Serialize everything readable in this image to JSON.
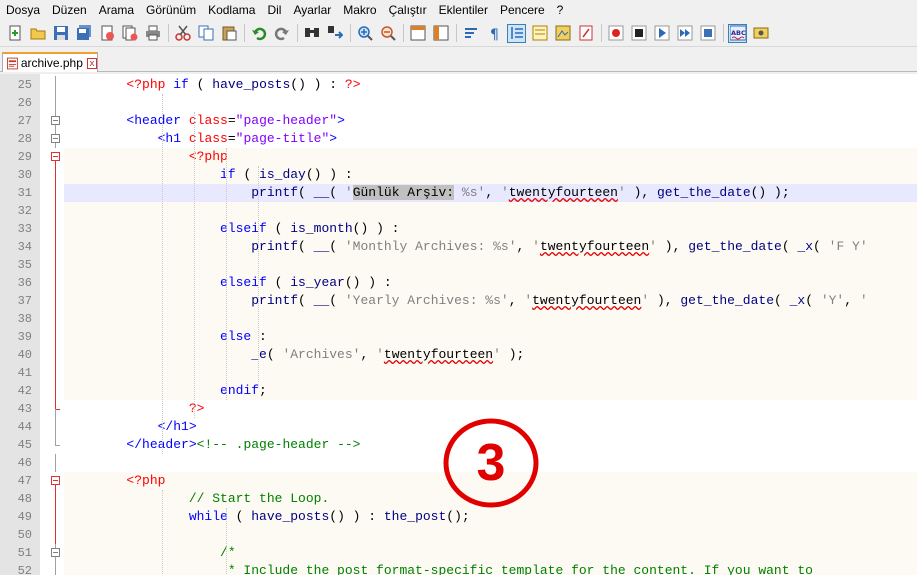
{
  "menu": [
    "Dosya",
    "Düzen",
    "Arama",
    "Görünüm",
    "Kodlama",
    "Dil",
    "Ayarlar",
    "Makro",
    "Çalıştır",
    "Eklentiler",
    "Pencere",
    "?"
  ],
  "tab": {
    "filename": "archive.php",
    "close": "x"
  },
  "badge": "3",
  "toolbar_icons": [
    "new-file-icon",
    "open-file-icon",
    "save-icon",
    "save-all-icon",
    "close-icon",
    "close-all-icon",
    "print-icon",
    "cut-icon",
    "copy-icon",
    "paste-icon",
    "undo-icon",
    "redo-icon",
    "find-icon",
    "replace-icon",
    "zoom-in-icon",
    "zoom-out-icon",
    "sync-v-icon",
    "sync-h-icon",
    "word-wrap-icon",
    "show-all-chars-icon",
    "indent-guide-icon",
    "udl-icon",
    "doc-map-icon",
    "function-list-icon",
    "record-macro-icon",
    "stop-macro-icon",
    "play-macro-icon",
    "run-macro-multiple-icon",
    "save-macro-icon",
    "spell-check-icon",
    "spell-options-icon"
  ],
  "lines": [
    {
      "n": "25",
      "bg": false,
      "cur": false,
      "fold": "line",
      "tokens": [
        [
          "t",
          "        "
        ],
        [
          "ph",
          "<?php"
        ],
        [
          "t",
          " "
        ],
        [
          "kw",
          "if"
        ],
        [
          "pu",
          " ( "
        ],
        [
          "fn",
          "have_posts"
        ],
        [
          "pu",
          "() ) : "
        ],
        [
          "ph",
          "?>"
        ]
      ]
    },
    {
      "n": "26",
      "bg": false,
      "cur": false,
      "fold": "line",
      "tokens": []
    },
    {
      "n": "27",
      "bg": false,
      "cur": false,
      "fold": "box",
      "tokens": [
        [
          "t",
          "        "
        ],
        [
          "tg",
          "<header"
        ],
        [
          "t",
          " "
        ],
        [
          "at",
          "class"
        ],
        [
          "pu",
          "="
        ],
        [
          "av",
          "\"page-header\""
        ],
        [
          "tg",
          ">"
        ]
      ]
    },
    {
      "n": "28",
      "bg": false,
      "cur": false,
      "fold": "box",
      "tokens": [
        [
          "t",
          "            "
        ],
        [
          "tg",
          "<h1"
        ],
        [
          "t",
          " "
        ],
        [
          "at",
          "class"
        ],
        [
          "pu",
          "="
        ],
        [
          "av",
          "\"page-title\""
        ],
        [
          "tg",
          ">"
        ]
      ]
    },
    {
      "n": "29",
      "bg": true,
      "cur": false,
      "fold": "boxred",
      "tokens": [
        [
          "t",
          "                "
        ],
        [
          "ph",
          "<?php"
        ]
      ]
    },
    {
      "n": "30",
      "bg": true,
      "cur": false,
      "fold": "redline",
      "tokens": [
        [
          "t",
          "                    "
        ],
        [
          "kw",
          "if"
        ],
        [
          "pu",
          " ( "
        ],
        [
          "fn",
          "is_day"
        ],
        [
          "pu",
          "() ) :"
        ]
      ]
    },
    {
      "n": "31",
      "bg": true,
      "cur": true,
      "fold": "redline",
      "tokens": [
        [
          "t",
          "                        "
        ],
        [
          "fn",
          "printf"
        ],
        [
          "pu",
          "( "
        ],
        [
          "fn",
          "__"
        ],
        [
          "pu",
          "( "
        ],
        [
          "st",
          "'"
        ],
        [
          "sel",
          "Günlük Arşiv:"
        ],
        [
          "st",
          " %s'"
        ],
        [
          "pu",
          ", "
        ],
        [
          "st",
          "'"
        ],
        [
          "wavy",
          "twentyfourteen"
        ],
        [
          "st",
          "'"
        ],
        [
          "pu",
          " ), "
        ],
        [
          "fn",
          "get_the_date"
        ],
        [
          "pu",
          "() );"
        ]
      ]
    },
    {
      "n": "32",
      "bg": true,
      "cur": false,
      "fold": "redline",
      "tokens": []
    },
    {
      "n": "33",
      "bg": true,
      "cur": false,
      "fold": "redline",
      "tokens": [
        [
          "t",
          "                    "
        ],
        [
          "kw",
          "elseif"
        ],
        [
          "pu",
          " ( "
        ],
        [
          "fn",
          "is_month"
        ],
        [
          "pu",
          "() ) :"
        ]
      ]
    },
    {
      "n": "34",
      "bg": true,
      "cur": false,
      "fold": "redline",
      "tokens": [
        [
          "t",
          "                        "
        ],
        [
          "fn",
          "printf"
        ],
        [
          "pu",
          "( "
        ],
        [
          "fn",
          "__"
        ],
        [
          "pu",
          "( "
        ],
        [
          "st",
          "'Monthly Archives: %s'"
        ],
        [
          "pu",
          ", "
        ],
        [
          "st",
          "'"
        ],
        [
          "wavy",
          "twentyfourteen"
        ],
        [
          "st",
          "'"
        ],
        [
          "pu",
          " ), "
        ],
        [
          "fn",
          "get_the_date"
        ],
        [
          "pu",
          "( "
        ],
        [
          "fn",
          "_x"
        ],
        [
          "pu",
          "( "
        ],
        [
          "st",
          "'F Y'"
        ]
      ]
    },
    {
      "n": "35",
      "bg": true,
      "cur": false,
      "fold": "redline",
      "tokens": []
    },
    {
      "n": "36",
      "bg": true,
      "cur": false,
      "fold": "redline",
      "tokens": [
        [
          "t",
          "                    "
        ],
        [
          "kw",
          "elseif"
        ],
        [
          "pu",
          " ( "
        ],
        [
          "fn",
          "is_year"
        ],
        [
          "pu",
          "() ) :"
        ]
      ]
    },
    {
      "n": "37",
      "bg": true,
      "cur": false,
      "fold": "redline",
      "tokens": [
        [
          "t",
          "                        "
        ],
        [
          "fn",
          "printf"
        ],
        [
          "pu",
          "( "
        ],
        [
          "fn",
          "__"
        ],
        [
          "pu",
          "( "
        ],
        [
          "st",
          "'Yearly Archives: %s'"
        ],
        [
          "pu",
          ", "
        ],
        [
          "st",
          "'"
        ],
        [
          "wavy",
          "twentyfourteen"
        ],
        [
          "st",
          "'"
        ],
        [
          "pu",
          " ), "
        ],
        [
          "fn",
          "get_the_date"
        ],
        [
          "pu",
          "( "
        ],
        [
          "fn",
          "_x"
        ],
        [
          "pu",
          "( "
        ],
        [
          "st",
          "'Y'"
        ],
        [
          "pu",
          ", "
        ],
        [
          "st",
          "'"
        ]
      ]
    },
    {
      "n": "38",
      "bg": true,
      "cur": false,
      "fold": "redline",
      "tokens": []
    },
    {
      "n": "39",
      "bg": true,
      "cur": false,
      "fold": "redline",
      "tokens": [
        [
          "t",
          "                    "
        ],
        [
          "kw",
          "else"
        ],
        [
          "pu",
          " :"
        ]
      ]
    },
    {
      "n": "40",
      "bg": true,
      "cur": false,
      "fold": "redline",
      "tokens": [
        [
          "t",
          "                        "
        ],
        [
          "fn",
          "_e"
        ],
        [
          "pu",
          "( "
        ],
        [
          "st",
          "'Archives'"
        ],
        [
          "pu",
          ", "
        ],
        [
          "st",
          "'"
        ],
        [
          "wavy",
          "twentyfourteen"
        ],
        [
          "st",
          "'"
        ],
        [
          "pu",
          " );"
        ]
      ]
    },
    {
      "n": "41",
      "bg": true,
      "cur": false,
      "fold": "redline",
      "tokens": []
    },
    {
      "n": "42",
      "bg": true,
      "cur": false,
      "fold": "redline",
      "tokens": [
        [
          "t",
          "                    "
        ],
        [
          "kw",
          "endif"
        ],
        [
          "pu",
          ";"
        ]
      ]
    },
    {
      "n": "43",
      "bg": false,
      "cur": false,
      "fold": "redend",
      "tokens": [
        [
          "t",
          "                "
        ],
        [
          "ph",
          "?>"
        ]
      ]
    },
    {
      "n": "44",
      "bg": false,
      "cur": false,
      "fold": "line",
      "tokens": [
        [
          "t",
          "            "
        ],
        [
          "tg",
          "</h1>"
        ]
      ]
    },
    {
      "n": "45",
      "bg": false,
      "cur": false,
      "fold": "end",
      "tokens": [
        [
          "t",
          "        "
        ],
        [
          "tg",
          "</header>"
        ],
        [
          "cm",
          "<!-- .page-header -->"
        ]
      ]
    },
    {
      "n": "46",
      "bg": false,
      "cur": false,
      "fold": "line",
      "tokens": []
    },
    {
      "n": "47",
      "bg": true,
      "cur": false,
      "fold": "boxred",
      "tokens": [
        [
          "t",
          "        "
        ],
        [
          "ph",
          "<?php"
        ]
      ]
    },
    {
      "n": "48",
      "bg": true,
      "cur": false,
      "fold": "redline",
      "tokens": [
        [
          "t",
          "                "
        ],
        [
          "cm",
          "// Start the Loop."
        ]
      ]
    },
    {
      "n": "49",
      "bg": true,
      "cur": false,
      "fold": "redline",
      "tokens": [
        [
          "t",
          "                "
        ],
        [
          "kw",
          "while"
        ],
        [
          "pu",
          " ( "
        ],
        [
          "fn",
          "have_posts"
        ],
        [
          "pu",
          "() ) : "
        ],
        [
          "fn",
          "the_post"
        ],
        [
          "pu",
          "();"
        ]
      ]
    },
    {
      "n": "50",
      "bg": true,
      "cur": false,
      "fold": "redline",
      "tokens": []
    },
    {
      "n": "51",
      "bg": true,
      "cur": false,
      "fold": "box",
      "tokens": [
        [
          "t",
          "                    "
        ],
        [
          "cm",
          "/*"
        ]
      ]
    },
    {
      "n": "52",
      "bg": true,
      "cur": false,
      "fold": "line",
      "tokens": [
        [
          "t",
          "                     "
        ],
        [
          "cm",
          "* Include the post format-specific template for the content. If you want to"
        ]
      ]
    }
  ]
}
